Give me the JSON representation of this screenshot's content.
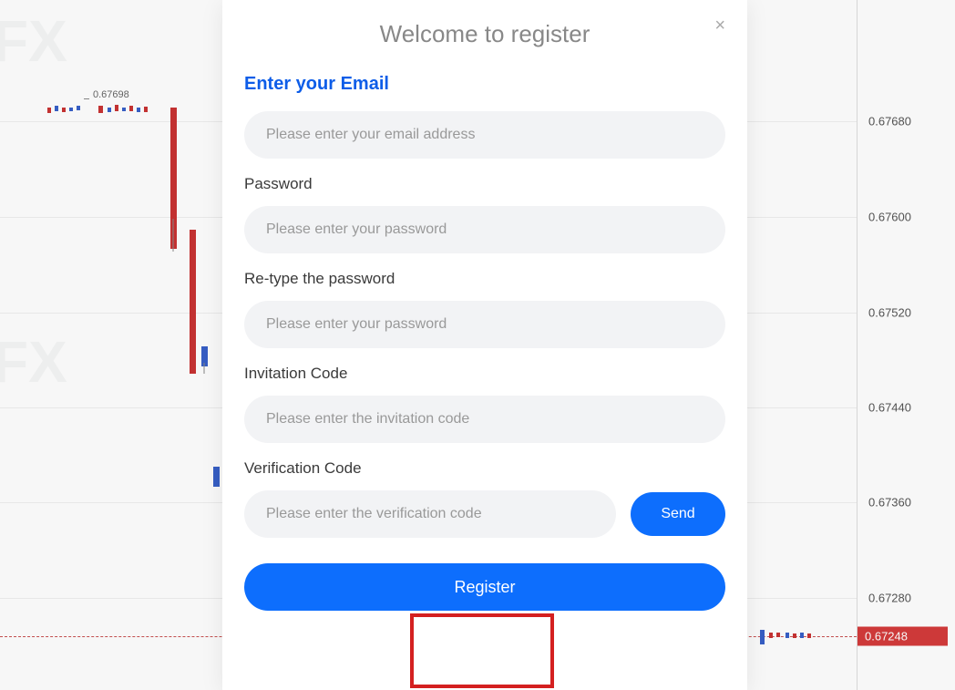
{
  "modal": {
    "title": "Welcome to register",
    "close_label": "×",
    "email": {
      "label": "Enter your Email",
      "placeholder": "Please enter your email address"
    },
    "password": {
      "label": "Password",
      "placeholder": "Please enter your password"
    },
    "password_confirm": {
      "label": "Re-type the password",
      "placeholder": "Please enter your password"
    },
    "invitation": {
      "label": "Invitation Code",
      "placeholder": "Please enter the invitation code"
    },
    "verification": {
      "label": "Verification Code",
      "placeholder": "Please enter the verification code",
      "send_button": "Send"
    },
    "register_button": "Register"
  },
  "chart": {
    "axis_labels": [
      "0.67680",
      "0.67600",
      "0.67520",
      "0.67440",
      "0.67360",
      "0.67280"
    ],
    "axis_highlight": "0.67248",
    "price_callout": "0.67698",
    "watermark_text": "WikiFX",
    "bg_text": "FX"
  }
}
